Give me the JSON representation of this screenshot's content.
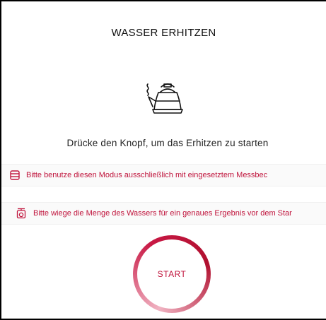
{
  "screen": {
    "title": "WASSER ERHITZEN",
    "icon": "kettle-icon",
    "instruction": "Drücke den Knopf, um das Erhitzen zu starten"
  },
  "hints": [
    {
      "icon": "measuring-cup-icon",
      "text": "Bitte benutze diesen Modus ausschließlich mit eingesetztem Messbec"
    },
    {
      "icon": "scale-icon",
      "text": "Bitte wiege die Menge des Wassers für ein genaues Ergebnis vor dem Star"
    }
  ],
  "start_button": {
    "label": "START"
  },
  "colors": {
    "accent": "#c0143c",
    "accent_light": "#f0b3c2",
    "background": "#ffffff",
    "text": "#222222"
  }
}
